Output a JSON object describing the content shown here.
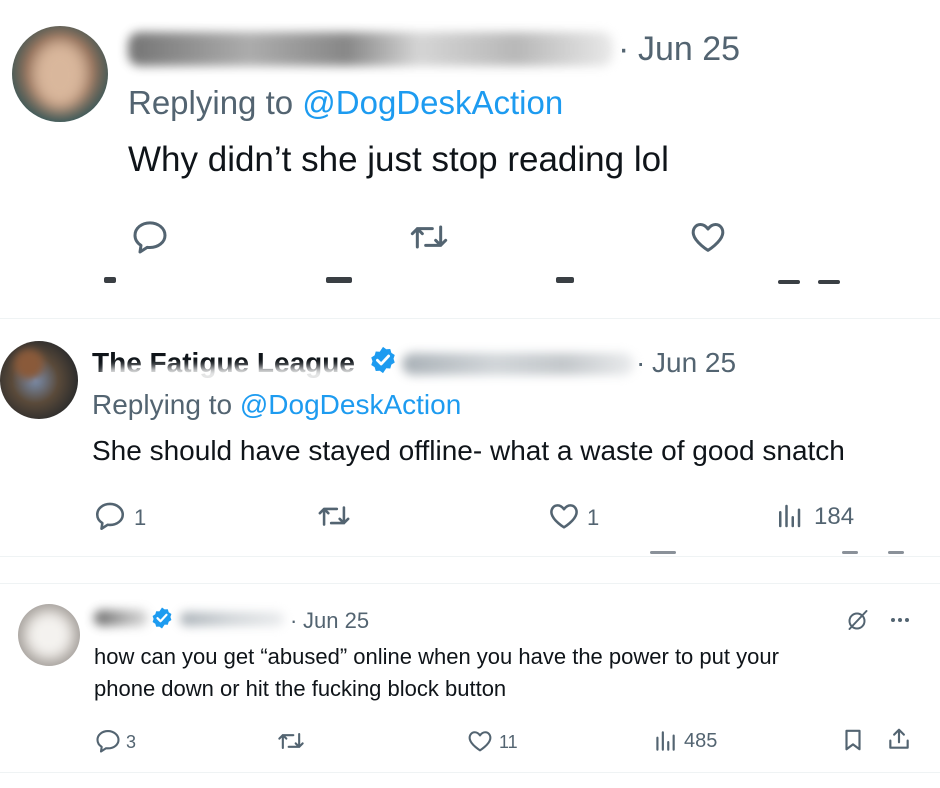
{
  "colors": {
    "text": "#0f1419",
    "secondary": "#536471",
    "link": "#1d9bf0",
    "divider": "#eff3f4"
  },
  "tweet1": {
    "display_name": "",
    "date_sep": "·",
    "date": "Jun 25",
    "replying_prefix": "Replying to",
    "replying_handle": "@DogDeskAction",
    "text": "Why didn’t she just stop reading lol",
    "icons": [
      "reply-icon",
      "retweet-icon",
      "like-icon"
    ]
  },
  "tweet2": {
    "display_name": "The Fatigue League",
    "verified": true,
    "date_sep": "·",
    "date": "Jun 25",
    "replying_prefix": "Replying to",
    "replying_handle": "@DogDeskAction",
    "text": "She should have stayed offline- what a waste of good snatch",
    "reply_count": "1",
    "like_count": "1",
    "view_count": "184"
  },
  "tweet3": {
    "verified": true,
    "date_sep": "·",
    "date": "Jun 25",
    "text_line1": "how can you get “abused” online when you have the power to put your",
    "text_line2": "phone down or hit the fucking block button",
    "reply_count": "3",
    "like_count": "11",
    "view_count": "485"
  }
}
